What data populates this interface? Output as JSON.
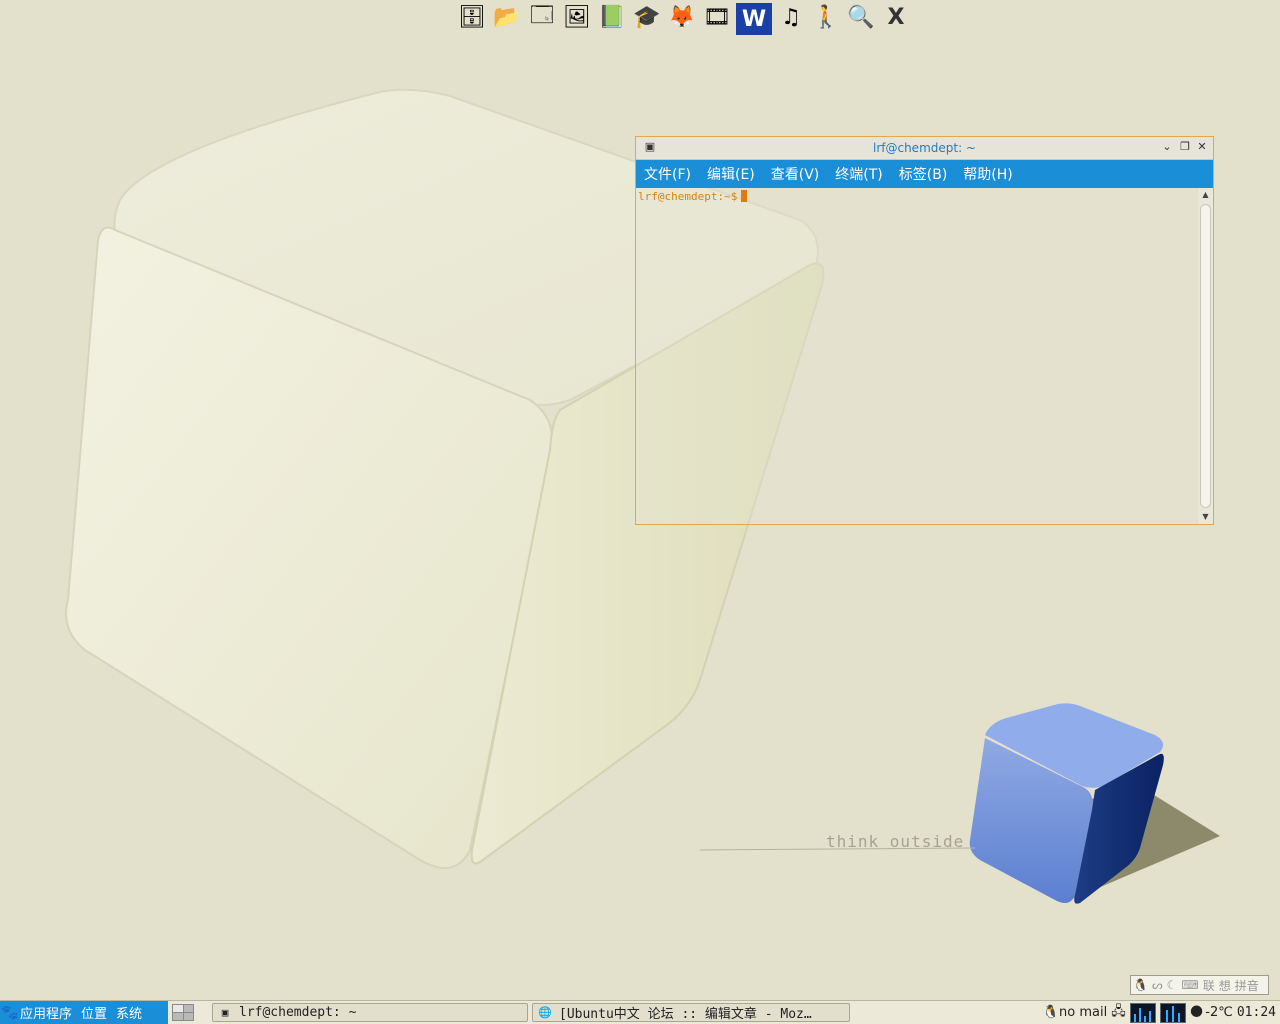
{
  "wallpaper": {
    "tagline": "think outside"
  },
  "dock": {
    "items": [
      {
        "name": "archive-icon",
        "glyph": "🗄"
      },
      {
        "name": "file-manager-icon",
        "glyph": "📂"
      },
      {
        "name": "window-icon",
        "glyph": "🗔"
      },
      {
        "name": "photo-viewer-icon",
        "glyph": "🖼"
      },
      {
        "name": "dictionary-icon",
        "glyph": "📗"
      },
      {
        "name": "education-icon",
        "glyph": "🎓"
      },
      {
        "name": "gimp-icon",
        "glyph": "🦊"
      },
      {
        "name": "video-film-icon",
        "glyph": "🎞"
      },
      {
        "name": "word-processor-icon",
        "glyph": "W"
      },
      {
        "name": "music-player-icon",
        "glyph": "♫"
      },
      {
        "name": "messenger-icon",
        "glyph": "🚶"
      },
      {
        "name": "terminal-search-icon",
        "glyph": "🔍"
      },
      {
        "name": "x-app-icon",
        "glyph": "X"
      }
    ]
  },
  "terminal": {
    "title": "lrf@chemdept: ~",
    "menu": [
      "文件(F)",
      "编辑(E)",
      "查看(V)",
      "终端(T)",
      "标签(B)",
      "帮助(H)"
    ],
    "prompt": "lrf@chemdept:~$"
  },
  "panel": {
    "app_menu": [
      "应用程序",
      "位置",
      "系统"
    ],
    "tasks": [
      {
        "label": "lrf@chemdept: ~"
      },
      {
        "label": "[Ubuntu中文 论坛 :: 编辑文章 - Moz…"
      }
    ],
    "tray": {
      "mail": "no mail",
      "weather": "-2℃",
      "clock": "01:24"
    }
  },
  "ime": {
    "items": [
      "联",
      "想",
      "拼音"
    ]
  },
  "colors": {
    "accent": "#1b8ed8",
    "window_border": "#e9a54a",
    "prompt": "#d9820e"
  }
}
